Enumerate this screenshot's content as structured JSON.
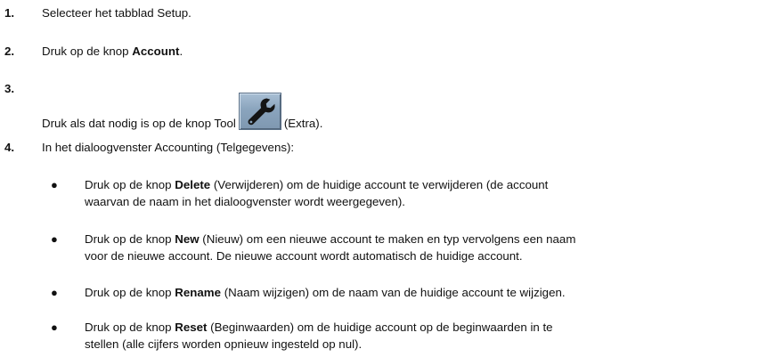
{
  "steps": [
    {
      "number": "1.",
      "text": "Selecteer het tabblad Setup."
    },
    {
      "number": "2.",
      "before": "Druk op de knop ",
      "bold": "Account",
      "after": "."
    },
    {
      "number": "3.",
      "before": "Druk als dat nodig is op de knop Tool",
      "icon": "wrench-icon",
      "after": "(Extra)."
    },
    {
      "number": "4.",
      "text": "In het dialoogvenster Accounting (Telgegevens):"
    }
  ],
  "bullets": [
    {
      "marker": "●",
      "before": "Druk op de knop ",
      "bold": "Delete",
      "line1_after": " (Verwijderen) om de huidige account te verwijderen (de account",
      "line2": "waarvan de naam in het dialoogvenster wordt weergegeven)."
    },
    {
      "marker": "●",
      "before": "Druk op de knop ",
      "bold": "New",
      "line1_after": " (Nieuw) om een nieuwe account te maken en typ vervolgens een naam",
      "line2": "voor de nieuwe account. De nieuwe account wordt automatisch de huidige account."
    },
    {
      "marker": "●",
      "before": "Druk op de knop ",
      "bold": "Rename",
      "line1_after": " (Naam wijzigen) om de naam van de huidige account te wijzigen."
    },
    {
      "marker": "●",
      "before": "Druk op de knop ",
      "bold": "Reset",
      "line1_after": " (Beginwaarden) om de huidige account op de beginwaarden in te",
      "line2": "stellen (alle cijfers worden opnieuw ingesteld op nul)."
    }
  ]
}
